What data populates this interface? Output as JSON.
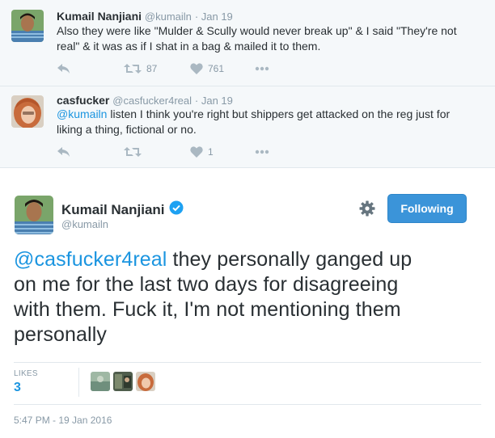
{
  "context_tweets": [
    {
      "name": "Kumail Nanjiani",
      "screen_name": "@kumailn",
      "date": "· Jan 19",
      "text_line1": "Also they were like \"Mulder & Scully would never break up\" & I said \"They're not",
      "text_line2": "real\" & it was as if I shat in a bag & mailed it to them.",
      "retweets": "87",
      "likes": "761"
    },
    {
      "name": "casfucker",
      "screen_name": "@casfucker4real",
      "date": "· Jan 19",
      "mention": "@kumailn",
      "text_line1_rest": " listen I think you're right but shippers get attacked on the reg just for",
      "text_line2": "liking a thing, fictional or no.",
      "retweets": "",
      "likes": "1"
    }
  ],
  "main_tweet": {
    "name": "Kumail Nanjiani",
    "screen_name": "@kumailn",
    "follow_label": "Following",
    "mention": "@casfucker4real",
    "text_line1_rest": " they personally ganged up",
    "text_line2": "on me for the last two days for disagreeing",
    "text_line3": "with them. Fuck it, I'm not mentioning them",
    "text_line4": "personally",
    "likes_label": "LIKES",
    "likes_count": "3",
    "timestamp": "5:47 PM - 19 Jan 2016"
  },
  "icons": {
    "reply": "reply-icon",
    "retweet": "retweet-icon",
    "like": "heart-icon",
    "more": "more-icon",
    "verified": "verified-badge-icon",
    "gear": "gear-icon"
  },
  "colors": {
    "accent": "#1b95e0",
    "follow_button": "#3b94d9",
    "muted": "#8899a6",
    "icon": "#aab8c2"
  }
}
